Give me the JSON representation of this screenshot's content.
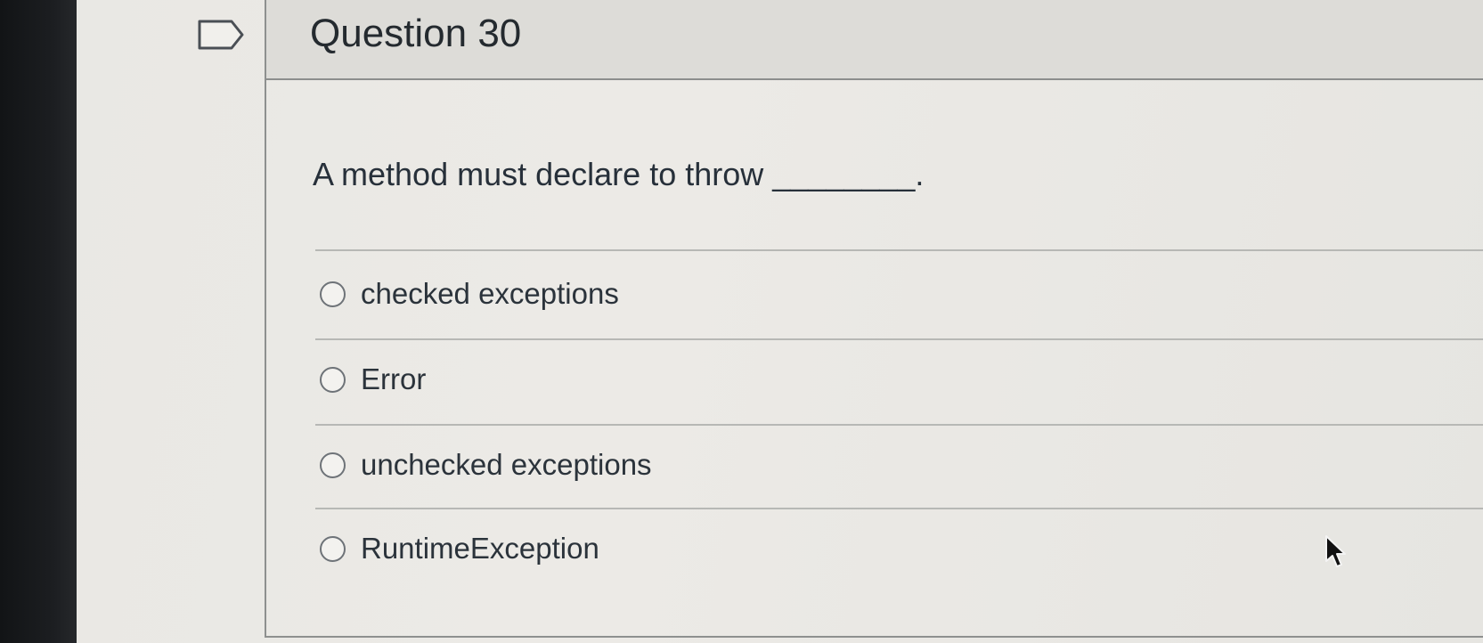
{
  "question": {
    "title": "Question 30",
    "prompt": "A method must declare to throw ________.",
    "answers": [
      {
        "label": "checked exceptions",
        "selected": false
      },
      {
        "label": "Error",
        "selected": false
      },
      {
        "label": "unchecked exceptions",
        "selected": false
      },
      {
        "label": "RuntimeException",
        "selected": false
      }
    ]
  },
  "icons": {
    "flag": "flag-outline-icon",
    "cursor": "mouse-pointer-icon"
  },
  "colors": {
    "header_bg": "#dddcd8",
    "page_bg": "#e9e8e4",
    "text": "#27303a",
    "border": "#8e908f"
  }
}
